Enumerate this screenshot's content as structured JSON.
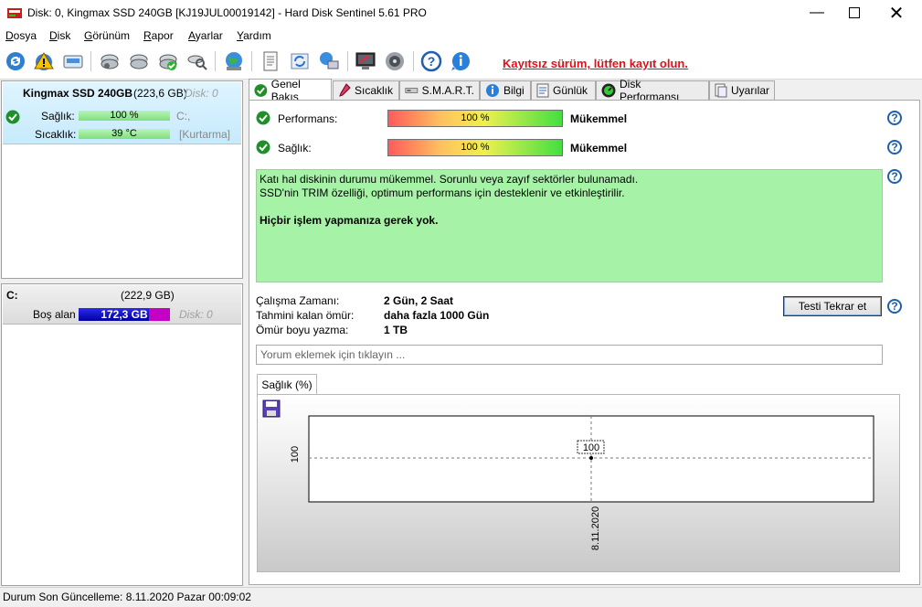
{
  "window": {
    "title": "Disk: 0, Kingmax SSD 240GB [KJ19JUL00019142]  -  Hard Disk Sentinel 5.61 PRO"
  },
  "menu": {
    "items": [
      {
        "pre": "D",
        "rest": "osya"
      },
      {
        "pre": "D",
        "rest": "isk"
      },
      {
        "pre": "G",
        "rest": "örünüm"
      },
      {
        "pre": "R",
        "rest": "apor"
      },
      {
        "pre": "A",
        "rest": "yarlar"
      },
      {
        "pre": "Y",
        "rest": "ardım"
      }
    ]
  },
  "toolbar": {
    "icons": [
      "refresh-icon",
      "warning-icon",
      "disk-info-icon",
      "disk-test-icon",
      "disk-surface-icon",
      "disk-check-icon",
      "disk-search-icon",
      "globe-icon",
      "report-icon",
      "sync-icon",
      "network-icon",
      "monitor-icon",
      "speaker-icon",
      "help-icon",
      "info-icon"
    ],
    "register_link": "Kayıtsız sürüm, lütfen kayıt olun."
  },
  "disk_card": {
    "name": "Kingmax SSD 240GB",
    "size": "(223,6 GB)",
    "disk_no": "Disk: 0",
    "health_label": "Sağlık:",
    "health_value": "100 %",
    "health_fraction": 1.0,
    "drive_letter": "C:,",
    "temp_label": "Sıcaklık:",
    "temp_value": "39 °C",
    "temp_note": "[Kurtarma]"
  },
  "volume_card": {
    "letter": "C:",
    "size": "(222,9 GB)",
    "free_label": "Boş alan",
    "free_value": "172,3 GB",
    "free_fraction": 0.773,
    "disk_no": "Disk: 0"
  },
  "tabs": [
    {
      "label": "Genel Bakış",
      "icon": "check-icon",
      "active": true
    },
    {
      "label": "Sıcaklık",
      "icon": "thermometer-icon",
      "active": false
    },
    {
      "label": "S.M.A.R.T.",
      "icon": "smart-icon",
      "active": false
    },
    {
      "label": "Bilgi",
      "icon": "info-icon",
      "active": false
    },
    {
      "label": "Günlük",
      "icon": "log-icon",
      "active": false
    },
    {
      "label": "Disk Performansı",
      "icon": "performance-icon",
      "active": false
    },
    {
      "label": "Uyarılar",
      "icon": "alerts-icon",
      "active": false
    }
  ],
  "overview": {
    "performance_label": "Performans:",
    "performance_value": "100 %",
    "performance_rating": "Mükemmel",
    "health_label": "Sağlık:",
    "health_value": "100 %",
    "health_rating": "Mükemmel",
    "status_line1": "Katı hal diskinin durumu mükemmel. Sorunlu veya zayıf sektörler bulunamadı.",
    "status_line2": "SSD'nin TRIM özelliği, optimum performans için desteklenir ve etkinleştirilir.",
    "status_line3": "Hiçbir işlem yapmanıza gerek yok.",
    "uptime_label": "Çalışma Zamanı:",
    "uptime_value": "2 Gün, 2 Saat",
    "remaining_label": "Tahmini kalan ömür:",
    "remaining_value": "daha fazla 1000 Gün",
    "written_label": "Ömür boyu yazma:",
    "written_value": "1 TB",
    "retest_button": "Testi Tekrar et",
    "comment_placeholder": "Yorum eklemek için tıklayın ..."
  },
  "chart_tab": "Sağlık (%)",
  "chart_data": {
    "type": "line",
    "x": [
      "8.11.2020"
    ],
    "series": [
      {
        "values": [
          100
        ]
      }
    ],
    "yticks": [
      "100"
    ],
    "data_labels": [
      "100"
    ]
  },
  "status_bar": "Durum Son Güncelleme: 8.11.2020 Pazar 00:09:02"
}
